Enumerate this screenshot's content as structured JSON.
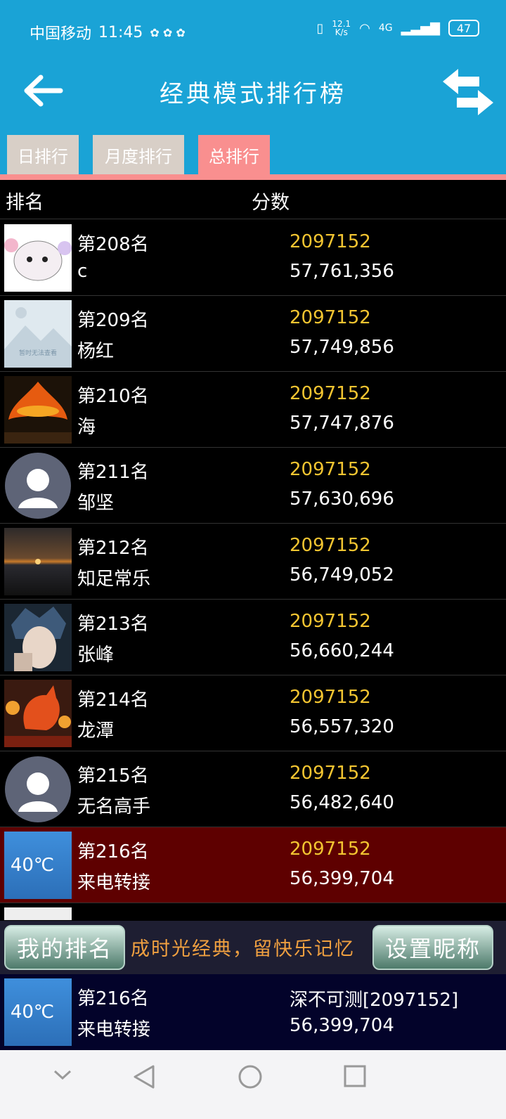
{
  "status_bar": {
    "carrier": "中国移动",
    "time": "11:45",
    "net_speed_value": "12.1",
    "net_speed_unit": "K/s",
    "network": "4G",
    "battery": "47"
  },
  "header": {
    "title": "经典模式排行榜"
  },
  "tabs": [
    {
      "label": "日排行",
      "active": false
    },
    {
      "label": "月度排行",
      "active": false
    },
    {
      "label": "总排行",
      "active": true
    }
  ],
  "columns": {
    "rank": "排名",
    "score": "分数"
  },
  "rows": [
    {
      "rank": "第208名",
      "name": "c",
      "level": "2097152",
      "score": "57,761,356",
      "avatar": "cartoon-cat",
      "highlight": false
    },
    {
      "rank": "第209名",
      "name": "杨红",
      "level": "2097152",
      "score": "57,749,856",
      "avatar": "placeholder-image",
      "highlight": false
    },
    {
      "rank": "第210名",
      "name": "海",
      "level": "2097152",
      "score": "57,747,876",
      "avatar": "sculpture-night",
      "highlight": false
    },
    {
      "rank": "第211名",
      "name": "邹坚",
      "level": "2097152",
      "score": "57,630,696",
      "avatar": "default-user",
      "highlight": false
    },
    {
      "rank": "第212名",
      "name": "知足常乐",
      "level": "2097152",
      "score": "56,749,052",
      "avatar": "sunset",
      "highlight": false
    },
    {
      "rank": "第213名",
      "name": "张峰",
      "level": "2097152",
      "score": "56,660,244",
      "avatar": "anime-boy",
      "highlight": false
    },
    {
      "rank": "第214名",
      "name": "龙潭",
      "level": "2097152",
      "score": "56,557,320",
      "avatar": "lantern-rooster",
      "highlight": false
    },
    {
      "rank": "第215名",
      "name": "无名高手",
      "level": "2097152",
      "score": "56,482,640",
      "avatar": "default-user",
      "highlight": false
    },
    {
      "rank": "第216名",
      "name": "来电转接",
      "level": "2097152",
      "score": "56,399,704",
      "avatar": "weather-card",
      "highlight": true
    }
  ],
  "weather_avatar_text": "40℃",
  "placeholder_avatar_text": "暂时无法查看",
  "bottom_bar": {
    "my_rank_button": "我的排名",
    "slogan": "成时光经典，留快乐记忆",
    "set_nickname_button": "设置昵称"
  },
  "my_entry": {
    "rank": "第216名",
    "name": "来电转接",
    "title": "深不可测[2097152]",
    "score": "56,399,704"
  },
  "colors": {
    "header_bg": "#1aa3d6",
    "tab_active": "#f98f8f",
    "tab_inactive": "#d8cfc7",
    "level_text": "#f3c531",
    "highlight_row": "#5e0000",
    "slogan_text": "#f0a040"
  }
}
